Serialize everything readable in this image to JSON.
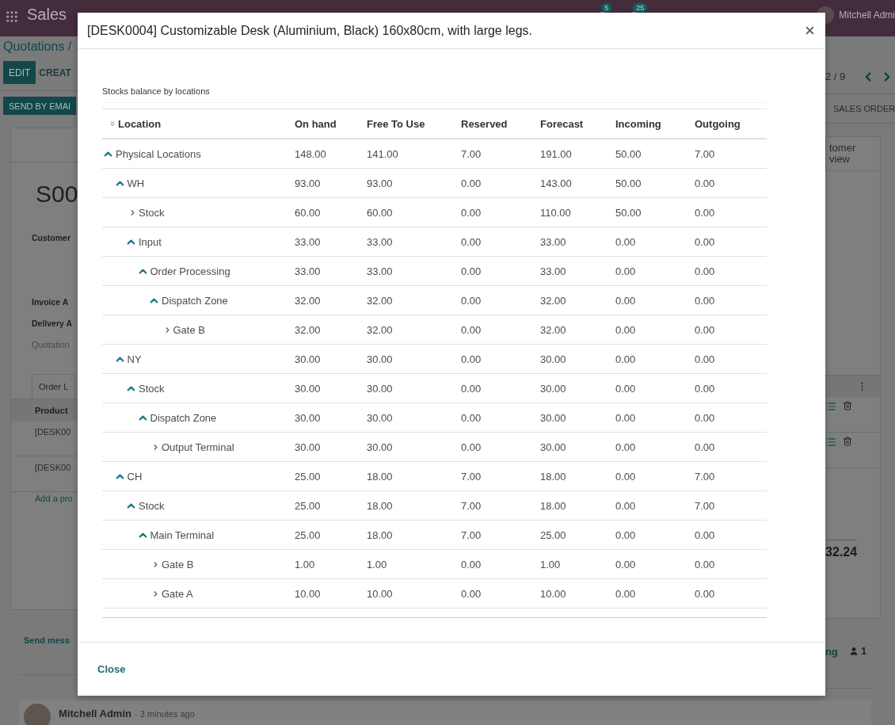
{
  "topbar": {
    "app": "Sales",
    "badges": [
      {
        "kind": "chat",
        "count": "5"
      },
      {
        "kind": "activity",
        "count": "25"
      }
    ],
    "user": "Mitchell Admi"
  },
  "background": {
    "breadcrumb": "Quotations /",
    "buttons": [
      {
        "kind": "primary",
        "label": "EDIT"
      },
      {
        "kind": "link",
        "label": "CREAT"
      }
    ],
    "send_button": "SEND BY EMAI",
    "pager": "2 / 9",
    "status": "SALES ORDER",
    "smart_button": "tomer view",
    "order_number": "S00",
    "fields": [
      "Customer",
      "Invoice A",
      "Delivery A"
    ],
    "field_hint": "Quotation",
    "tab": "Order L",
    "column": "Product",
    "lines": [
      "[DESK00",
      "[DESK00"
    ],
    "add_line": "Add a pro",
    "total": "32.24",
    "chatter": {
      "send": "Send mess",
      "following": "ng",
      "followers": "1",
      "author": "Mitchell Admin",
      "time": "- 3 minutes ago"
    }
  },
  "dialog": {
    "title": "[DESK0004] Customizable Desk (Aluminium, Black) 160x80cm, with large legs.",
    "subtitle": "Stocks balance by locations",
    "columns": [
      "Location",
      "On hand",
      "Free To Use",
      "Reserved",
      "Forecast",
      "Incoming",
      "Outgoing"
    ],
    "rows": [
      {
        "name": "Physical Locations",
        "expanded": true,
        "values": [
          "148.00",
          "141.00",
          "7.00",
          "191.00",
          "50.00",
          "7.00"
        ],
        "children": [
          {
            "name": "WH",
            "expanded": true,
            "values": [
              "93.00",
              "93.00",
              "0.00",
              "143.00",
              "50.00",
              "0.00"
            ],
            "children": [
              {
                "name": "Stock",
                "expanded": false,
                "values": [
                  "60.00",
                  "60.00",
                  "0.00",
                  "110.00",
                  "50.00",
                  "0.00"
                ]
              },
              {
                "name": "Input",
                "expanded": true,
                "values": [
                  "33.00",
                  "33.00",
                  "0.00",
                  "33.00",
                  "0.00",
                  "0.00"
                ],
                "children": [
                  {
                    "name": "Order Processing",
                    "expanded": true,
                    "values": [
                      "33.00",
                      "33.00",
                      "0.00",
                      "33.00",
                      "0.00",
                      "0.00"
                    ],
                    "children": [
                      {
                        "name": "Dispatch Zone",
                        "expanded": true,
                        "values": [
                          "32.00",
                          "32.00",
                          "0.00",
                          "32.00",
                          "0.00",
                          "0.00"
                        ],
                        "children": [
                          {
                            "name": "Gate B",
                            "expanded": false,
                            "values": [
                              "32.00",
                              "32.00",
                              "0.00",
                              "32.00",
                              "0.00",
                              "0.00"
                            ]
                          }
                        ]
                      }
                    ]
                  }
                ]
              }
            ]
          },
          {
            "name": "NY",
            "expanded": true,
            "values": [
              "30.00",
              "30.00",
              "0.00",
              "30.00",
              "0.00",
              "0.00"
            ],
            "children": [
              {
                "name": "Stock",
                "expanded": true,
                "values": [
                  "30.00",
                  "30.00",
                  "0.00",
                  "30.00",
                  "0.00",
                  "0.00"
                ],
                "children": [
                  {
                    "name": "Dispatch Zone",
                    "expanded": true,
                    "values": [
                      "30.00",
                      "30.00",
                      "0.00",
                      "30.00",
                      "0.00",
                      "0.00"
                    ],
                    "children": [
                      {
                        "name": "Output Terminal",
                        "expanded": false,
                        "values": [
                          "30.00",
                          "30.00",
                          "0.00",
                          "30.00",
                          "0.00",
                          "0.00"
                        ]
                      }
                    ]
                  }
                ]
              }
            ]
          },
          {
            "name": "CH",
            "expanded": true,
            "values": [
              "25.00",
              "18.00",
              "7.00",
              "18.00",
              "0.00",
              "7.00"
            ],
            "children": [
              {
                "name": "Stock",
                "expanded": true,
                "values": [
                  "25.00",
                  "18.00",
                  "7.00",
                  "18.00",
                  "0.00",
                  "7.00"
                ],
                "children": [
                  {
                    "name": "Main Terminal",
                    "expanded": true,
                    "values": [
                      "25.00",
                      "18.00",
                      "7.00",
                      "25.00",
                      "0.00",
                      "0.00"
                    ],
                    "children": [
                      {
                        "name": "Gate B",
                        "expanded": false,
                        "values": [
                          "1.00",
                          "1.00",
                          "0.00",
                          "1.00",
                          "0.00",
                          "0.00"
                        ]
                      },
                      {
                        "name": "Gate A",
                        "expanded": false,
                        "values": [
                          "10.00",
                          "10.00",
                          "0.00",
                          "10.00",
                          "0.00",
                          "0.00"
                        ]
                      }
                    ]
                  }
                ]
              }
            ]
          }
        ]
      }
    ],
    "close": "Close"
  }
}
